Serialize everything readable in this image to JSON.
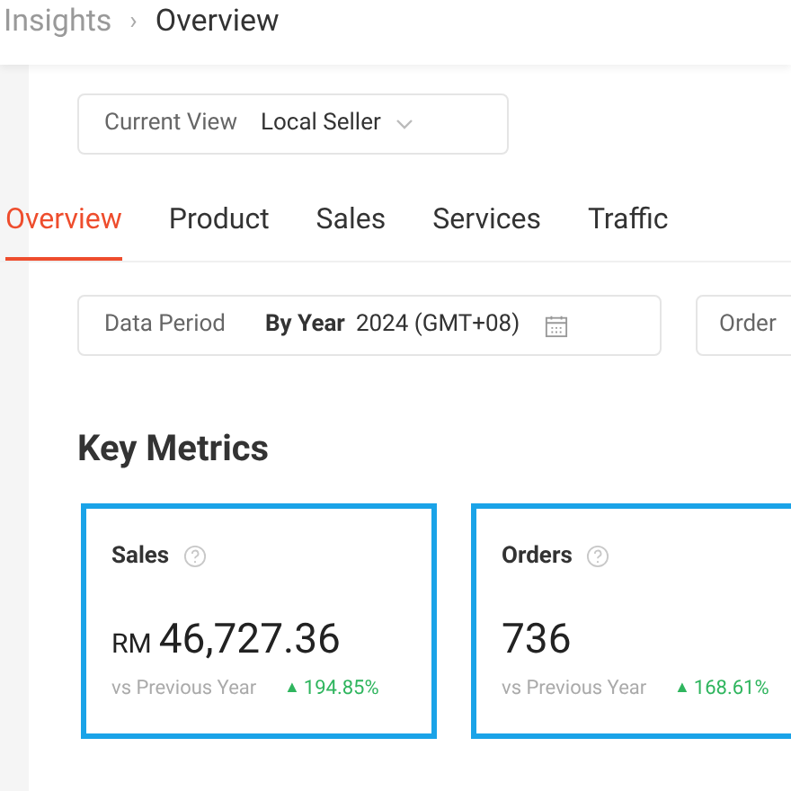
{
  "breadcrumb": [
    "Insights",
    "Overview"
  ],
  "breadcrumb_separator": "›",
  "view_selector": {
    "label": "Current View",
    "value": "Local Seller"
  },
  "tabs": [
    {
      "label": "Overview",
      "selected": true
    },
    {
      "label": "Product",
      "selected": false
    },
    {
      "label": "Sales",
      "selected": false
    },
    {
      "label": "Services",
      "selected": false
    },
    {
      "label": "Traffic",
      "selected": false
    }
  ],
  "data_period": {
    "label": "Data Period",
    "mode": "By Year",
    "value": "2024 (GMT+08)"
  },
  "order_filter": {
    "label": "Order"
  },
  "section_title": "Key Metrics",
  "metrics": [
    {
      "name": "Sales",
      "currency": "RM",
      "value": "46,727.36",
      "comparison": "vs Previous Year",
      "change": "194.85%",
      "arrow": "▲",
      "highlighted": true
    },
    {
      "name": "Orders",
      "value": "736",
      "comparison": "vs Previous Year",
      "change": "168.61%",
      "arrow": "▲",
      "highlighted": true
    }
  ]
}
